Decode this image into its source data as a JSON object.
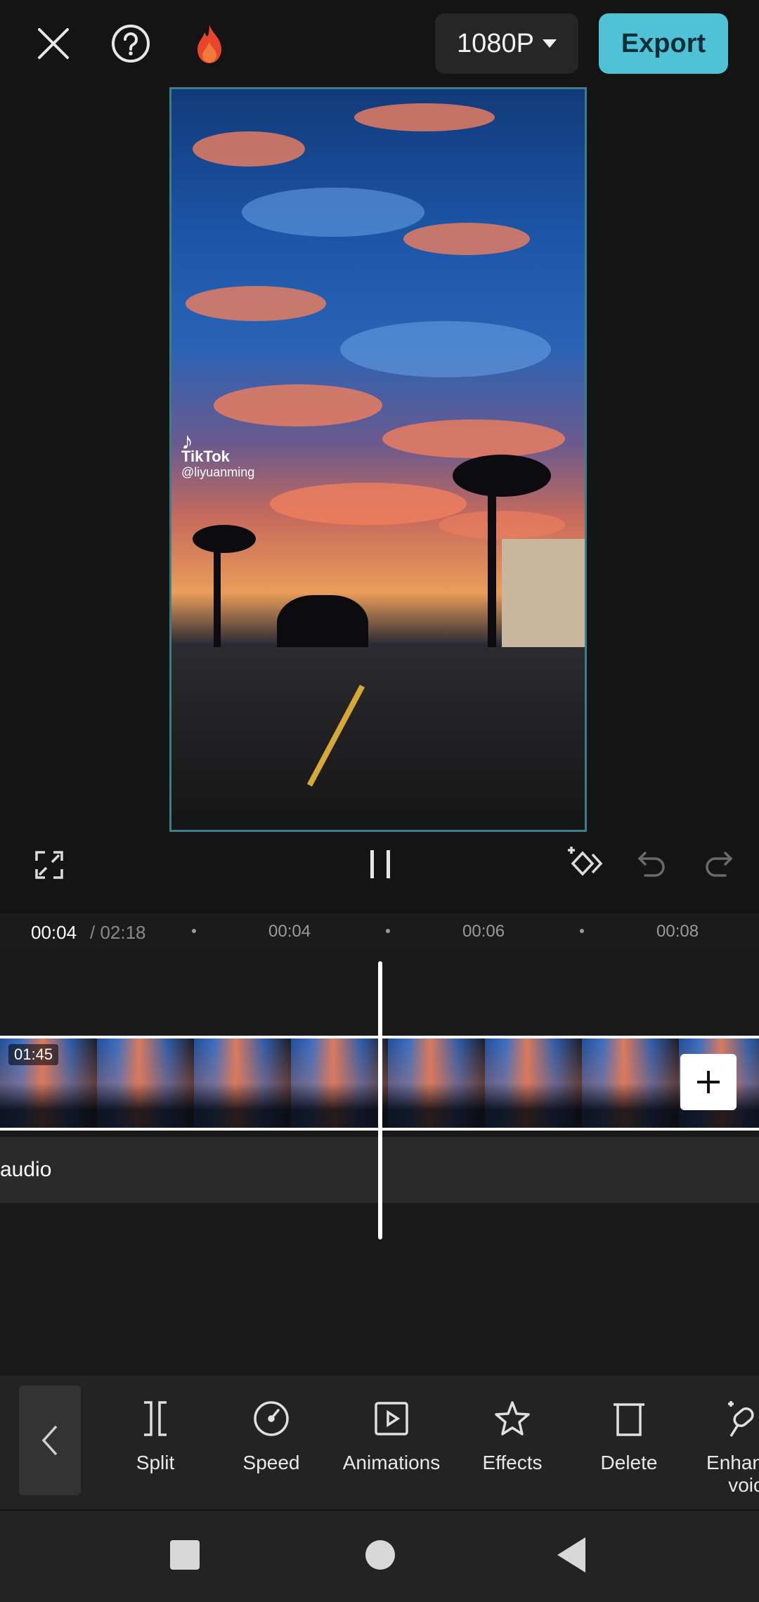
{
  "topbar": {
    "close_icon": "close-icon",
    "help_icon": "help-icon",
    "pro_icon": "flame-icon",
    "resolution": "1080P",
    "export_label": "Export",
    "accent_color": "#4fc2d6"
  },
  "preview": {
    "watermark_brand": "TikTok",
    "watermark_handle": "@liyuanming"
  },
  "controls": {
    "fullscreen_icon": "fullscreen-icon",
    "pause_icon": "pause-icon",
    "keyframe_icon": "keyframe-icon",
    "undo_icon": "undo-icon",
    "redo_icon": "redo-icon"
  },
  "timeline": {
    "current_time": "00:04",
    "total_time": "/ 02:18",
    "ticks": [
      "00:04",
      "00:06",
      "00:08"
    ],
    "clip_duration": "01:45",
    "audio_label": "audio"
  },
  "toolbar": {
    "items": [
      {
        "label": "Split",
        "icon": "split-icon"
      },
      {
        "label": "Speed",
        "icon": "speed-icon"
      },
      {
        "label": "Animations",
        "icon": "animations-icon"
      },
      {
        "label": "Effects",
        "icon": "effects-icon"
      },
      {
        "label": "Delete",
        "icon": "delete-icon"
      },
      {
        "label": "Enhan voic",
        "icon": "enhance-voice-icon"
      }
    ]
  },
  "navbar": {
    "recents_icon": "recents-icon",
    "home_icon": "home-icon",
    "back_icon": "back-icon"
  }
}
